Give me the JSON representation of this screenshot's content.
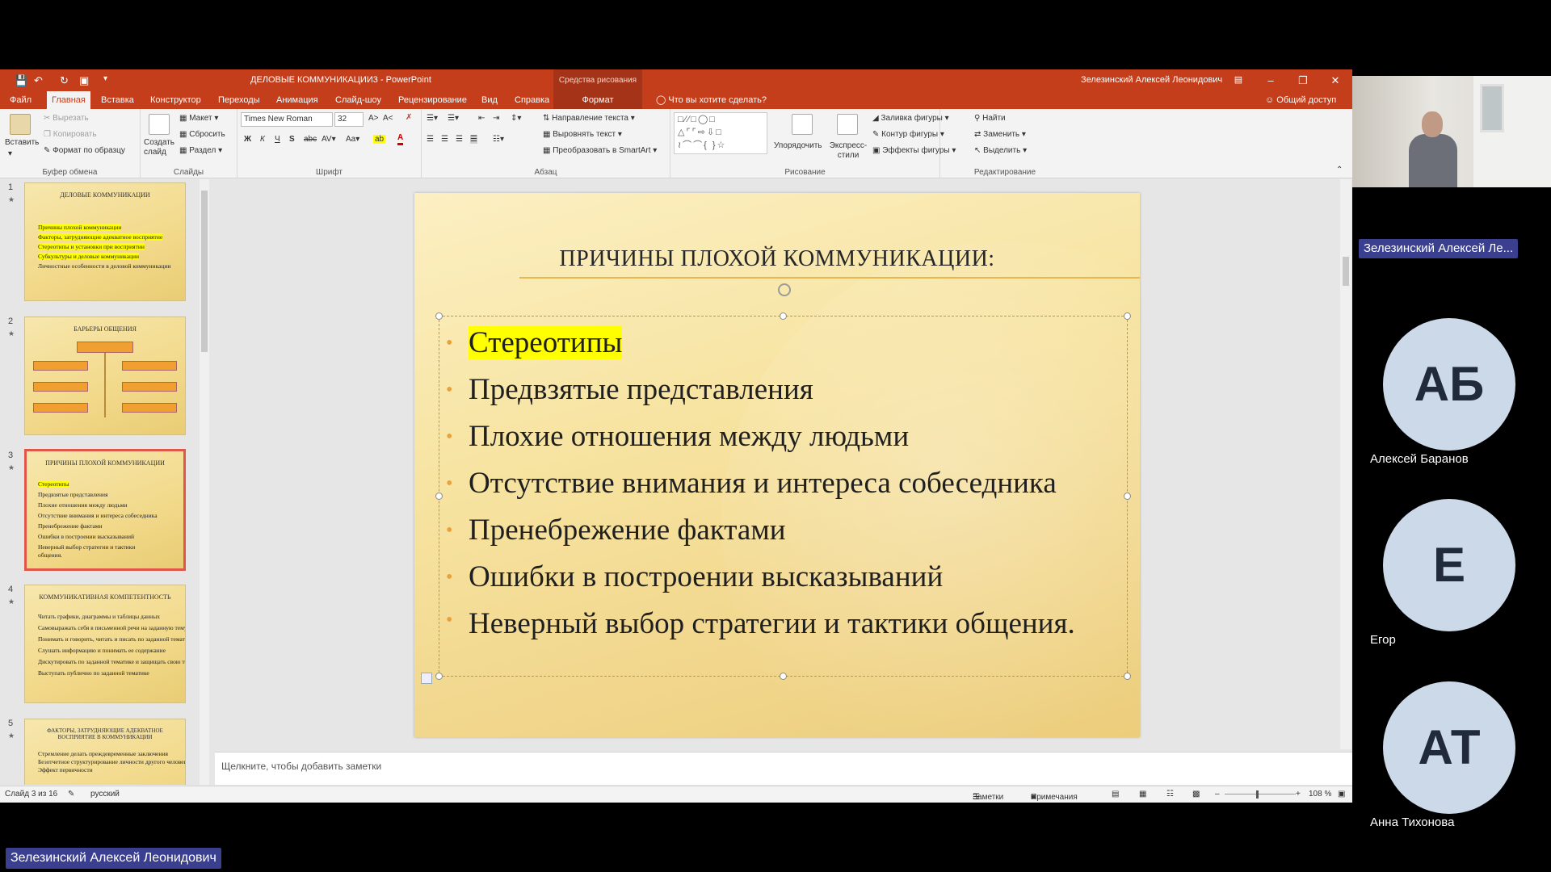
{
  "window": {
    "title": "ДЕЛОВЫЕ КОММУНИКАЦИИ3 - PowerPoint",
    "context_title": "Средства рисования",
    "user": "Зелезинский Алексей Леонидович"
  },
  "tabs": [
    {
      "label": "Файл"
    },
    {
      "label": "Главная"
    },
    {
      "label": "Вставка"
    },
    {
      "label": "Конструктор"
    },
    {
      "label": "Переходы"
    },
    {
      "label": "Анимация"
    },
    {
      "label": "Слайд-шоу"
    },
    {
      "label": "Рецензирование"
    },
    {
      "label": "Вид"
    },
    {
      "label": "Справка"
    },
    {
      "label": "Формат"
    }
  ],
  "tell_me": "Что вы хотите сделать?",
  "share": "Общий доступ",
  "ribbon": {
    "clipboard": {
      "paste": "Вставить",
      "cut": "Вырезать",
      "copy": "Копировать",
      "format_painter": "Формат по образцу",
      "label": "Буфер обмена"
    },
    "slides": {
      "new_slide": "Создать слайд",
      "layout": "Макет",
      "reset": "Сбросить",
      "section": "Раздел",
      "label": "Слайды"
    },
    "font": {
      "name": "Times New Roman",
      "size": "32",
      "bold": "Ж",
      "italic": "К",
      "underline": "Ч",
      "strike": "S",
      "label": "Шрифт"
    },
    "paragraph": {
      "text_direction": "Направление текста",
      "align_text": "Выровнять текст",
      "smartart": "Преобразовать в SmartArt",
      "label": "Абзац"
    },
    "drawing": {
      "arrange": "Упорядочить",
      "quick_styles": "Экспресс-стили",
      "fill": "Заливка фигуры",
      "outline": "Контур фигуры",
      "effects": "Эффекты фигуры",
      "label": "Рисование"
    },
    "editing": {
      "find": "Найти",
      "replace": "Заменить",
      "select": "Выделить",
      "label": "Редактирование"
    }
  },
  "thumbnails": [
    {
      "num": "1",
      "title": "ДЕЛОВЫЕ КОММУНИКАЦИИ",
      "lines": [
        "Причины плохой коммуникации",
        "Факторы, затрудняющие адекватное восприятие",
        "Стереотипы и установки при восприятии",
        "Субкультуры и деловые коммуникации",
        "Личностные особенности в деловой коммуникации"
      ]
    },
    {
      "num": "2",
      "title": "БАРЬЕРЫ ОБЩЕНИЯ",
      "lines": []
    },
    {
      "num": "3",
      "title": "ПРИЧИНЫ ПЛОХОЙ КОММУНИКАЦИИ",
      "lines": [
        "Стереотипы",
        "Предвзятые представления",
        "Плохие отношения между людьми",
        "Отсутствие внимания и интереса собеседника",
        "Пренебрежение фактами",
        "Ошибки в построении высказываний",
        "Неверный выбор стратегии и тактики",
        "общения."
      ]
    },
    {
      "num": "4",
      "title": "КОММУНИКАТИВНАЯ КОМПЕТЕНТНОСТЬ",
      "lines": [
        "Читать графики, диаграммы и таблицы данных",
        "Самовыражать себя в письменной речи на заданную тему",
        "Понимать и говорить, читать и писать по заданной тематике",
        "Слушать информацию и понимать ее содержание",
        "Дискутировать по заданной тематике и защищать свою точку зрения",
        "Выступать публично по заданной тематике"
      ]
    },
    {
      "num": "5",
      "title": "ФАКТОРЫ, ЗАТРУДНЯЮЩИЕ АДЕКВАТНОЕ ВОСПРИЯТИЕ В КОММУНИКАЦИИ",
      "lines": [
        "Стремление делать преждевременные заключения",
        "Безотчетное структурирование личности другого человека",
        "Эффект первичности"
      ]
    }
  ],
  "slide": {
    "title": "ПРИЧИНЫ ПЛОХОЙ КОММУНИКАЦИИ:",
    "bullets": [
      "Стереотипы",
      "Предвзятые представления",
      "Плохие отношения между людьми",
      "Отсутствие внимания и интереса собеседника",
      "Пренебрежение фактами",
      "Ошибки в построении высказываний",
      "Неверный выбор стратегии и тактики общения."
    ]
  },
  "notes_placeholder": "Щелкните, чтобы добавить заметки",
  "status": {
    "slide_count": "Слайд 3 из 16",
    "language": "русский",
    "notes": "Заметки",
    "comments": "Примечания",
    "zoom": "108 %"
  },
  "participants": {
    "presenter_label": "Зелезинский Алексей Ле...",
    "list": [
      {
        "initials": "АБ",
        "name": "Алексей Баранов"
      },
      {
        "initials": "Е",
        "name": "Егор"
      },
      {
        "initials": "АТ",
        "name": "Анна Тихонова"
      }
    ],
    "screen_owner": "Зелезинский Алексей Леонидович"
  },
  "colors": {
    "accent": "#c43e1c",
    "highlight": "#ffff00",
    "bullet": "#e8a23b",
    "avatar_bg": "#ccd9e8",
    "name_tag": "#3a3f8f"
  }
}
